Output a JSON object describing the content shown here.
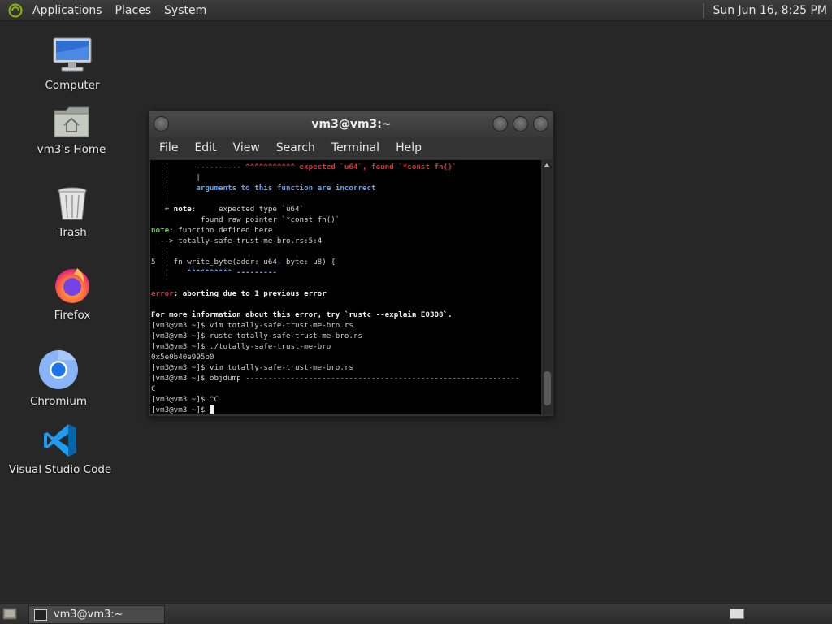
{
  "top_panel": {
    "menus": [
      "Applications",
      "Places",
      "System"
    ],
    "clock": "Sun Jun 16,  8:25 PM"
  },
  "desktop_icons": [
    {
      "label": "Computer",
      "icon": "computer-icon"
    },
    {
      "label": "vm3's Home",
      "icon": "home-folder-icon"
    },
    {
      "label": "Trash",
      "icon": "trash-icon"
    },
    {
      "label": "Firefox",
      "icon": "firefox-icon"
    },
    {
      "label": "Chromium",
      "icon": "chromium-icon"
    },
    {
      "label": "Visual Studio Code",
      "icon": "vscode-icon"
    }
  ],
  "terminal": {
    "title": "vm3@vm3:~",
    "menus": [
      "File",
      "Edit",
      "View",
      "Search",
      "Terminal",
      "Help"
    ],
    "lines": [
      [
        {
          "t": "   |      ---------- "
        },
        {
          "t": "^^^^^^^^^^^ expected `u64`, found `*const fn()`",
          "c": "red"
        }
      ],
      [
        {
          "t": "   |      |"
        }
      ],
      [
        {
          "t": "   |      "
        },
        {
          "t": "arguments to this function are incorrect",
          "c": "blue"
        }
      ],
      [
        {
          "t": "   |"
        }
      ],
      [
        {
          "t": "   = "
        },
        {
          "t": "note",
          "c": "bold"
        },
        {
          "t": ":     expected type `u64`"
        }
      ],
      [
        {
          "t": "           found raw pointer `*const fn()`"
        }
      ],
      [
        {
          "t": "note",
          "c": "green"
        },
        {
          "t": ": function defined here"
        }
      ],
      [
        {
          "t": "  --> totally-safe-trust-me-bro.rs:5:4"
        }
      ],
      [
        {
          "t": "   |"
        }
      ],
      [
        {
          "t": "5  | fn write_byte(addr: u64, byte: u8) {"
        }
      ],
      [
        {
          "t": "   |    ^^^^^^^^^^ ---------",
          "c": "blue"
        }
      ],
      [
        {
          "t": ""
        }
      ],
      [
        {
          "t": "error",
          "c": "red"
        },
        {
          "t": ": aborting due to 1 previous error",
          "c": "bold"
        }
      ],
      [
        {
          "t": ""
        }
      ],
      [
        {
          "t": "For more information about this error, try `rustc --explain E0308`.",
          "c": "bold"
        }
      ],
      [
        {
          "t": "[vm3@vm3 ~]$ vim totally-safe-trust-me-bro.rs"
        }
      ],
      [
        {
          "t": "[vm3@vm3 ~]$ rustc totally-safe-trust-me-bro.rs"
        }
      ],
      [
        {
          "t": "[vm3@vm3 ~]$ ./totally-safe-trust-me-bro"
        }
      ],
      [
        {
          "t": "0x5e0b40e995b0"
        }
      ],
      [
        {
          "t": "[vm3@vm3 ~]$ vim totally-safe-trust-me-bro.rs"
        }
      ],
      [
        {
          "t": "[vm3@vm3 ~]$ objdump -------------------------------------------------------------"
        }
      ],
      [
        {
          "t": "C"
        }
      ],
      [
        {
          "t": "[vm3@vm3 ~]$ ^C"
        }
      ],
      [
        {
          "t": "[vm3@vm3 ~]$ "
        }
      ]
    ]
  },
  "bottom_panel": {
    "task_label": "vm3@vm3:~"
  }
}
